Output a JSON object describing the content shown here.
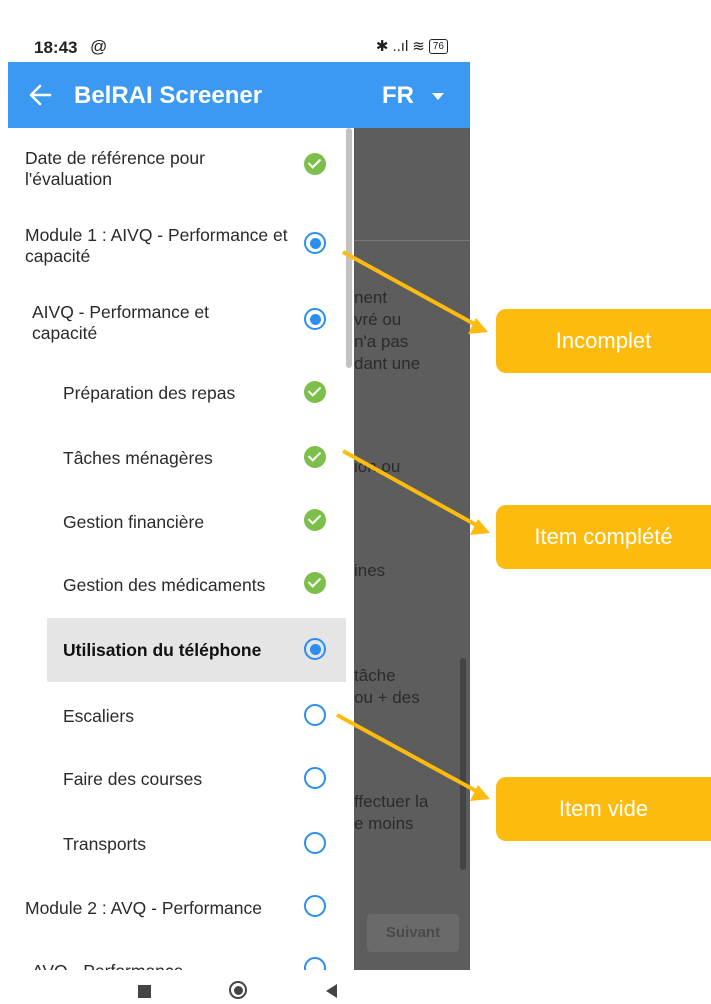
{
  "status_bar": {
    "time": "18:43",
    "alarm_glyph": "@",
    "bluetooth": "✱",
    "signal": "..ıl",
    "wifi": "≋",
    "battery": "76"
  },
  "app_bar": {
    "title": "BelRAI Screener",
    "language": "FR",
    "back_icon": "arrow-left-icon",
    "lang_icon": "caret-down-icon",
    "background": "#3c99f1"
  },
  "drawer": {
    "items": [
      {
        "label": "Date de référence pour l'évaluation",
        "state": "complete"
      },
      {
        "label": "Module 1 : AIVQ - Performance et capacité",
        "state": "incomplete"
      },
      {
        "label": "AIVQ - Performance et capacité",
        "state": "incomplete"
      },
      {
        "label": "Préparation des repas",
        "state": "complete"
      },
      {
        "label": "Tâches ménagères",
        "state": "complete"
      },
      {
        "label": "Gestion financière",
        "state": "complete"
      },
      {
        "label": "Gestion des médicaments",
        "state": "complete"
      },
      {
        "label": "Utilisation du téléphone",
        "state": "incomplete",
        "selected": true
      },
      {
        "label": "Escaliers",
        "state": "empty"
      },
      {
        "label": "Faire des courses",
        "state": "empty"
      },
      {
        "label": "Transports",
        "state": "empty"
      },
      {
        "label": "Module 2 : AVQ - Performance",
        "state": "empty"
      },
      {
        "label": "AVQ - Performance",
        "state": "empty"
      }
    ],
    "state_colors": {
      "complete": "#7cbf4a",
      "incomplete": "#2b8ef1",
      "empty": "#2b8ef1"
    }
  },
  "background_page": {
    "fragments": [
      "nent",
      "vré ou",
      "n'a pas",
      "dant une",
      "ion ou",
      "ines",
      "tâche",
      "ou + des",
      "ffectuer la",
      "e moins"
    ],
    "next_button": "Suivant"
  },
  "callouts": [
    {
      "label": "Incomplet"
    },
    {
      "label": "Item complété"
    },
    {
      "label": "Item vide"
    }
  ],
  "callout_color": "#fdbc0d"
}
